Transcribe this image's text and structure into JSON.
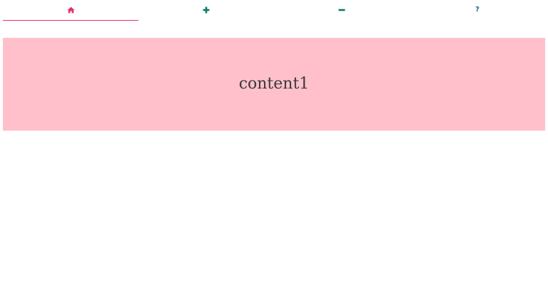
{
  "tabs": [
    {
      "icon": "home-icon",
      "active": true,
      "color": "#e8336a"
    },
    {
      "icon": "plus-icon",
      "active": false,
      "color": "#0a7a6a"
    },
    {
      "icon": "minus-icon",
      "active": false,
      "color": "#0a7a6a"
    },
    {
      "icon": "help-icon",
      "glyph": "?",
      "active": false,
      "color": "#137087"
    }
  ],
  "active_underline_color": "#e8336a",
  "panel": {
    "text": "content1",
    "background": "#ffc0cb"
  }
}
